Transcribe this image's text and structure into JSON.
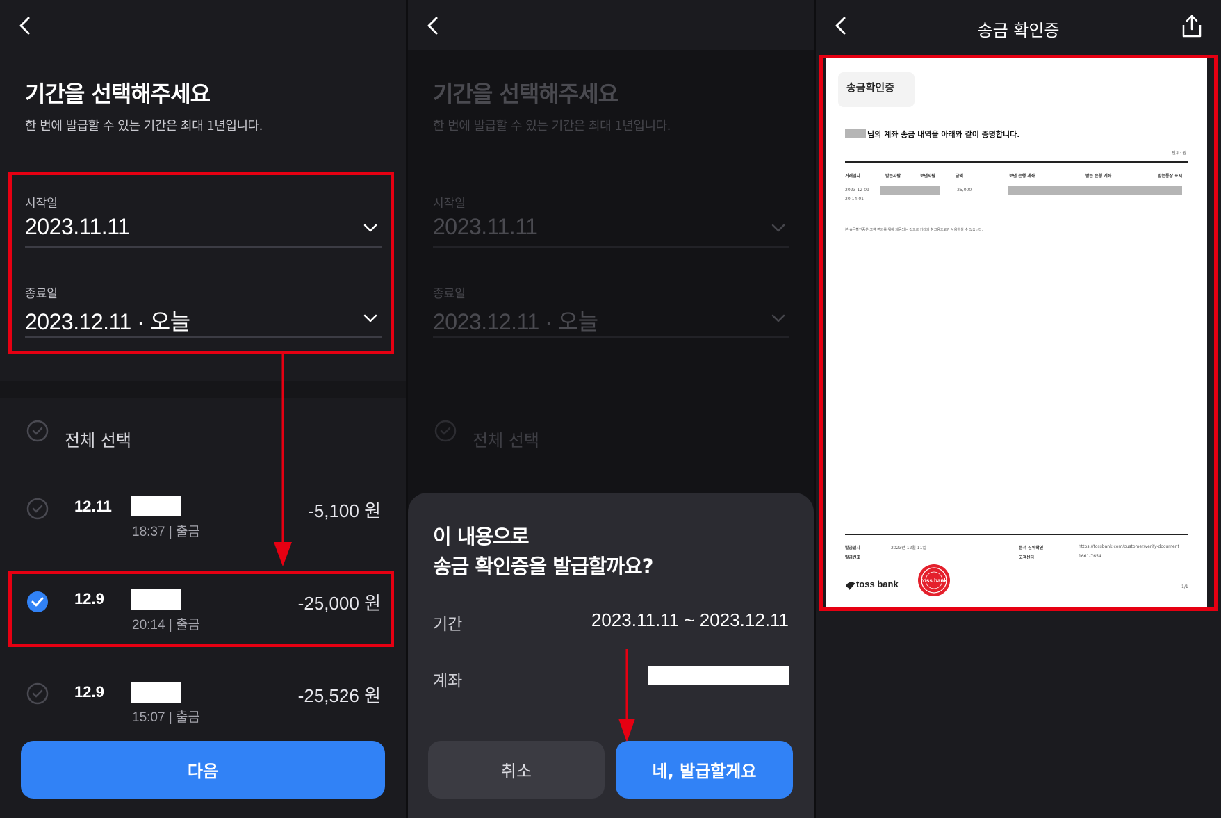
{
  "panel1": {
    "title": "기간을 선택해주세요",
    "subtitle": "한 번에 발급할 수 있는 기간은 최대 1년입니다.",
    "start_label": "시작일",
    "start_value": "2023.11.11",
    "end_label": "종료일",
    "end_value": "2023.12.11 · 오늘",
    "select_all": "전체 선택",
    "rows": [
      {
        "date": "12.11",
        "sub": "18:37 | 출금",
        "amount": "-5,100 원",
        "checked": false
      },
      {
        "date": "12.9",
        "sub": "20:14 | 출금",
        "amount": "-25,000 원",
        "checked": true
      },
      {
        "date": "12.9",
        "sub": "15:07 | 출금",
        "amount": "-25,526 원",
        "checked": false
      }
    ],
    "next_button": "다음"
  },
  "panel2": {
    "title": "기간을 선택해주세요",
    "subtitle": "한 번에 발급할 수 있는 기간은 최대 1년입니다.",
    "start_label": "시작일",
    "start_value": "2023.11.11",
    "end_label": "종료일",
    "end_value": "2023.12.11 · 오늘",
    "select_all": "전체 선택",
    "sheet": {
      "title_line1": "이 내용으로",
      "title_line2": "송금 확인증을 발급할까요?",
      "period_label": "기간",
      "period_value": "2023.11.11 ~ 2023.12.11",
      "account_label": "계좌",
      "cancel_button": "취소",
      "confirm_button": "네, 발급할게요"
    }
  },
  "panel3": {
    "header_title": "송금 확인증",
    "doc": {
      "tab_title": "송금확인증",
      "statement": "님의 계좌 송금 내역을 아래와 같이 증명합니다.",
      "unit": "단위: 원",
      "columns": [
        "거래일자",
        "받는사람",
        "보낸사람",
        "금액",
        "보낸 은행 계좌",
        "받는 은행 계좌",
        "받는통장 표시"
      ],
      "row_date": "2023-12-09",
      "row_time": "20:14:01",
      "row_amount": "-25,000",
      "note": "본 송금확인증은 고객 편의를 위해 제공되는 것으로 거래의 참고용으로만 사용하실 수 있습니다.",
      "issue_date_label": "발급일자",
      "issue_date": "2023년 12월 11일",
      "issue_no_label": "발급번호",
      "verify_label": "문서 진위확인",
      "verify_url": "https://tossbank.com/customer/verify-document",
      "center_label": "고객센터",
      "center_phone": "1661-7654",
      "logo_text": "toss bank",
      "seal_text": "toss bank",
      "page": "1/1"
    }
  },
  "colors": {
    "accent": "#3182f6",
    "highlight": "#e60012",
    "background": "#1b1b1f"
  }
}
